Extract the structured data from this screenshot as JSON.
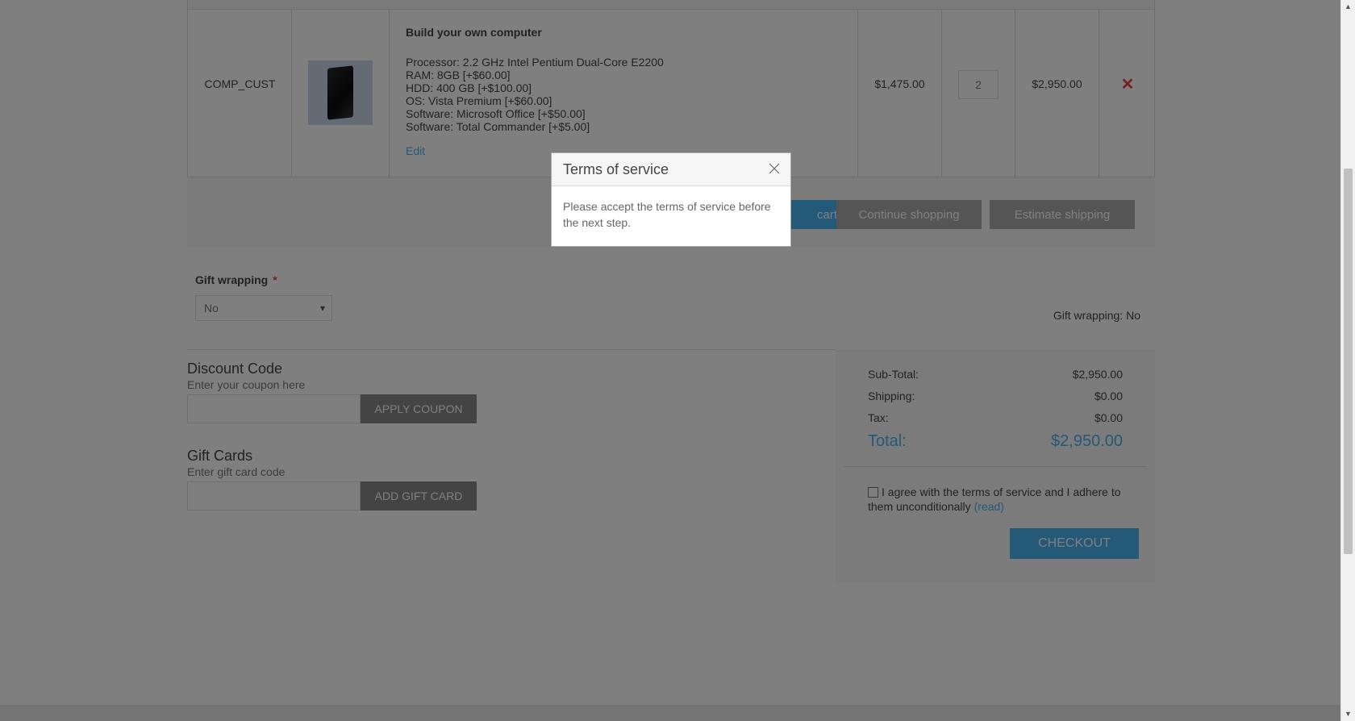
{
  "cart": {
    "item": {
      "sku": "COMP_CUST",
      "name": "Build your own computer",
      "attributes": [
        "Processor: 2.2 GHz Intel Pentium Dual-Core E2200",
        "RAM: 8GB [+$60.00]",
        "HDD: 400 GB [+$100.00]",
        "OS: Vista Premium [+$60.00]",
        "Software: Microsoft Office [+$50.00]",
        "Software: Total Commander [+$5.00]"
      ],
      "edit_label": "Edit",
      "unit_price": "$1,475.00",
      "quantity": "2",
      "total": "$2,950.00",
      "remove_icon": "close-icon"
    },
    "actions": {
      "update_label": "cart",
      "continue_label": "Continue shopping",
      "estimate_label": "Estimate shipping"
    }
  },
  "gift_wrapping": {
    "label": "Gift wrapping",
    "required_mark": "*",
    "selected": "No",
    "summary": "Gift wrapping: No"
  },
  "discount": {
    "title": "Discount Code",
    "hint": "Enter your coupon here",
    "button": "APPLY COUPON"
  },
  "gift_cards": {
    "title": "Gift Cards",
    "hint": "Enter gift card code",
    "button": "ADD GIFT CARD"
  },
  "totals": {
    "subtotal_label": "Sub-Total:",
    "subtotal_value": "$2,950.00",
    "shipping_label": "Shipping:",
    "shipping_value": "$0.00",
    "tax_label": "Tax:",
    "tax_value": "$0.00",
    "total_label": "Total:",
    "total_value": "$2,950.00",
    "tos_text": "I agree with the terms of service and I adhere to them unconditionally",
    "tos_read": "(read)",
    "checkout": "CHECKOUT"
  },
  "dialog": {
    "title": "Terms of service",
    "message": "Please accept the terms of service before the next step."
  },
  "colors": {
    "accent": "#4ab2f1",
    "danger": "#e4434b",
    "overlay": "rgba(0,0,0,0.5)"
  }
}
